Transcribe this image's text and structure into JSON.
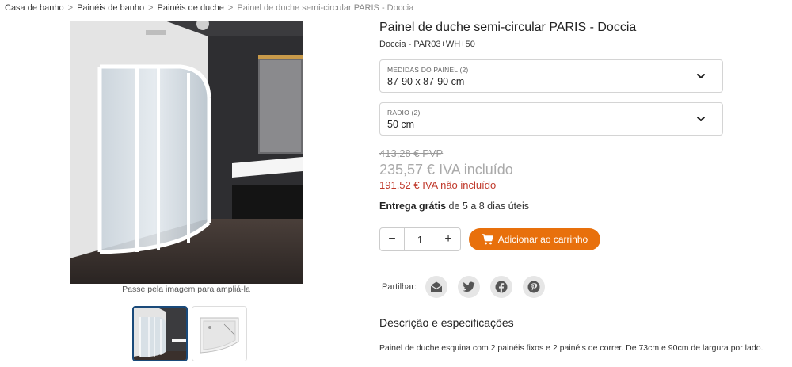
{
  "breadcrumb": {
    "items": [
      "Casa de banho",
      "Painéis de banho",
      "Painéis de duche"
    ],
    "current": "Painel de duche semi-circular PARIS - Doccia",
    "separator": ">"
  },
  "gallery": {
    "zoom_hint": "Passe pela imagem para ampliá-la",
    "thumbnails": [
      "shower-panel-photo",
      "shower-tray-photo"
    ]
  },
  "product": {
    "title": "Painel de duche semi-circular PARIS - Doccia",
    "sku": "Doccia - PAR03+WH+50"
  },
  "options": [
    {
      "label": "MEDIDAS DO PAINEL (2)",
      "value": "87-90 x 87-90 cm"
    },
    {
      "label": "RADIO (2)",
      "value": "50 cm"
    }
  ],
  "price": {
    "old": "413,28 €  PVP",
    "main": "235,57 €  IVA incluído",
    "net": "191,52 € IVA não incluído"
  },
  "delivery": {
    "bold": "Entrega grátis",
    "rest": " de 5 a 8 dias úteis"
  },
  "quantity": {
    "minus": "−",
    "value": "1",
    "plus": "+"
  },
  "cart": {
    "label": "Adicionar ao carrinho"
  },
  "share": {
    "label": "Partilhar:",
    "icons": [
      "email-icon",
      "twitter-icon",
      "facebook-icon",
      "pinterest-icon"
    ]
  },
  "description": {
    "title": "Descrição e especificações",
    "text": "Painel de duche esquina com 2 painéis fixos e 2 painéis de correr. De 73cm e 90cm de largura por lado."
  },
  "colors": {
    "accent": "#e8700c",
    "net_price": "#c0392b",
    "active_thumb_border": "#1a4a7a"
  }
}
